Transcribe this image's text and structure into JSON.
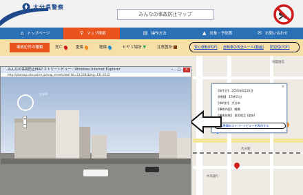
{
  "header": {
    "logo_text": "大分県警察",
    "site_title": "みんなの事故防止マップ"
  },
  "nav": {
    "items": [
      {
        "label": "トップページ",
        "icon": "home-icon"
      },
      {
        "label": "マップ検索",
        "icon": "map-pin-icon"
      },
      {
        "label": "操作方法",
        "icon": "book-icon"
      },
      {
        "label": "対象・予防策",
        "icon": "warning-icon"
      },
      {
        "label": "お問い合わせ",
        "icon": "mail-icon"
      }
    ]
  },
  "legend": {
    "title": "事故記号の種類",
    "items": [
      {
        "label": "死亡",
        "color": "#d01c1c"
      },
      {
        "label": "重傷",
        "color": "#f08a1c"
      },
      {
        "label": "軽傷",
        "color": "#2b8fd6"
      },
      {
        "label": "ヒヤリ場所",
        "color": "#2fa84f"
      },
      {
        "label": "注意箇所",
        "color": "#7a3b12"
      }
    ],
    "links": [
      "安心運転(PDF)",
      "自転車の安全ルール(動画)",
      "防犯性(PDF)"
    ]
  },
  "map": {
    "label_top_right": "地図送信",
    "label_town": "大分市",
    "label_station": "大分駅",
    "label_street": "中央通り"
  },
  "popup_window": {
    "title": "みんなの事故防止MAP ストリートビュー - Windows Internet Explorer",
    "url": "http://jikomap.oita-police.jp/map_street/view?lat=33.2381&lng=131.6112",
    "sv_address": "大分市",
    "zoom_plus": "+",
    "zoom_minus": "−"
  },
  "info_popup": {
    "rows": [
      {
        "label": "【発生日】",
        "value": "2016年6月26日"
      },
      {
        "label": "【時間】",
        "value": "17時15分"
      },
      {
        "label": "【市町村】",
        "value": "大分市"
      },
      {
        "label": "【事故内容】",
        "value": "軽傷"
      },
      {
        "label": "【事故形態】",
        "value": "車両相互 (追突)"
      }
    ],
    "link": "事故現場のストリートビューを表示する",
    "close": "×"
  },
  "colors": {
    "nav_bg": "#2b6fb5",
    "nav_active": "#e8541c",
    "legend_bg": "#f7dfa8"
  }
}
